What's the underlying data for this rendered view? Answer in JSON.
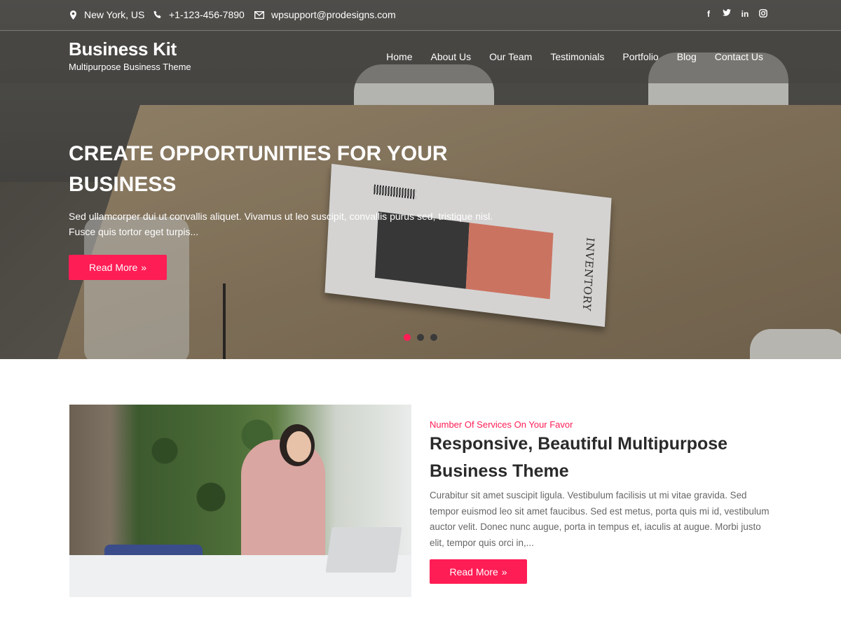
{
  "topbar": {
    "location": "New York, US",
    "phone": "+1-123-456-7890",
    "email": "wpsupport@prodesigns.com",
    "social": [
      "facebook-icon",
      "twitter-icon",
      "linkedin-icon",
      "instagram-icon"
    ]
  },
  "header": {
    "logo": "Business Kit",
    "tagline": "Multipurpose Business Theme",
    "nav": [
      "Home",
      "About Us",
      "Our Team",
      "Testimonials",
      "Portfolio",
      "Blog",
      "Contact Us"
    ]
  },
  "hero": {
    "title": "CREATE OPPORTUNITIES FOR YOUR BUSINESS",
    "description": "Sed ullamcorper dui ut convallis aliquet. Vivamus ut leo suscipit, convallis purus sed, tristique nisl. Fusce quis tortor eget turpis...",
    "button": "Read More",
    "magazine_title": "INVENTORY",
    "slides": 3,
    "active_slide": 1
  },
  "services": {
    "subheading": "Number Of Services On Your Favor",
    "title": "Responsive, Beautiful Multipurpose Business Theme",
    "description": "Curabitur sit amet suscipit ligula. Vestibulum facilisis ut mi vitae gravida. Sed tempor euismod leo sit amet faucibus. Sed est metus, porta quis mi id, vestibulum auctor velit. Donec nunc augue, porta in tempus et, iaculis at augue. Morbi justo elit, tempor quis orci in,...",
    "button": "Read More"
  },
  "colors": {
    "accent": "#ff1d55"
  }
}
